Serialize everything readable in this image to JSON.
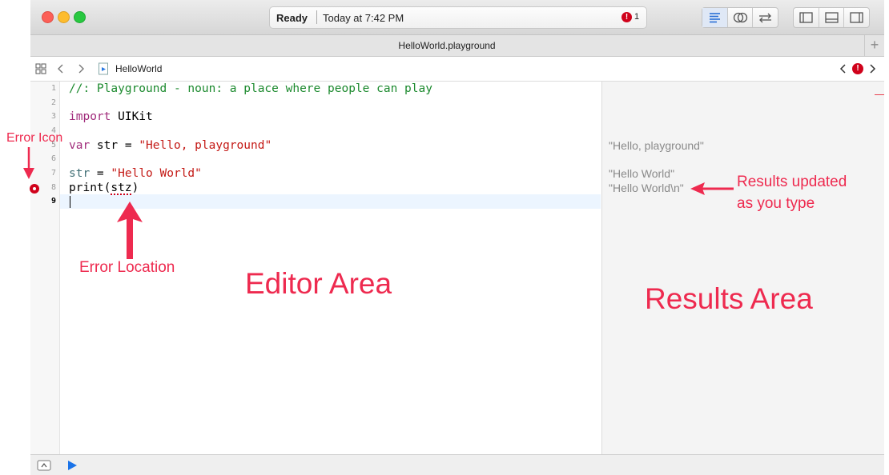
{
  "window": {
    "status": {
      "ready": "Ready",
      "time": "Today at 7:42 PM",
      "error_badge": "!",
      "error_count": "1"
    },
    "tab_title": "HelloWorld.playground",
    "tab_add": "+",
    "jumpbar": {
      "file_name": "HelloWorld",
      "error_badge": "!"
    }
  },
  "editor": {
    "line_numbers": [
      "1",
      "2",
      "3",
      "4",
      "5",
      "6",
      "7",
      "8",
      "9"
    ],
    "lines": {
      "l1": "//: Playground - noun: a place where people can play",
      "l3_kw": "import",
      "l3_rest": " UIKit",
      "l5_kw": "var",
      "l5_mid": " str = ",
      "l5_str": "\"Hello, playground\"",
      "l7_var": "str",
      "l7_mid": " = ",
      "l7_str": "\"Hello World\"",
      "l8_a": "print(",
      "l8_err": "stz",
      "l8_b": ")"
    }
  },
  "results": [
    "\"Hello, playground\"",
    "\"Hello World\"",
    "\"Hello World\\n\""
  ],
  "annotations": {
    "error_icon": "Error Icon",
    "error_location": "Error Location",
    "editor_area": "Editor Area",
    "results_updated_line1": "Results updated",
    "results_updated_line2": "as you type",
    "results_area": "Results Area"
  },
  "colors": {
    "annotation": "#ee2a4f",
    "error": "#d0021b",
    "comment": "#1c8a2e",
    "string": "#c41a16",
    "keyword": "#a12c7b"
  }
}
